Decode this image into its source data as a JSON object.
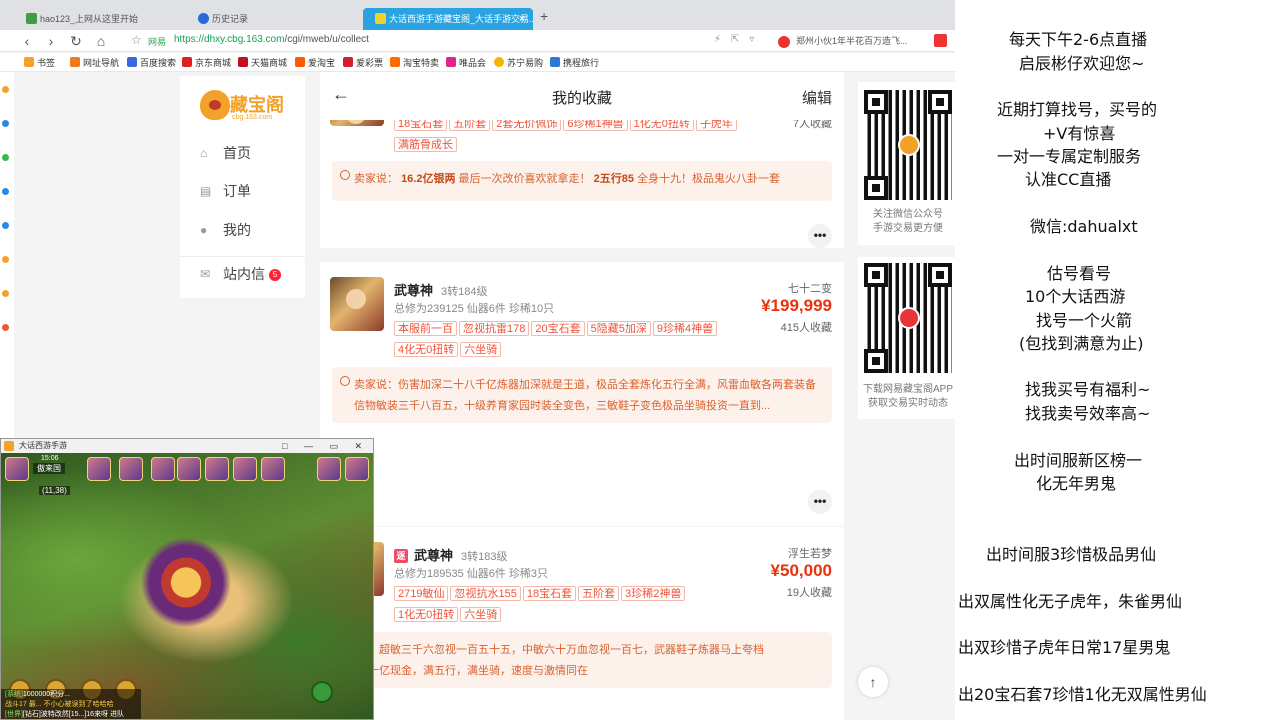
{
  "browser": {
    "tabs": [
      {
        "title": "hao123_上网从这里开始",
        "icon_color": "#3b9e4a"
      },
      {
        "title": "历史记录",
        "icon_color": "#2a6ad8"
      },
      {
        "title": "大话西游手游藏宝阁_大话手游交易...",
        "icon_color": "#f2a22a",
        "active": true
      }
    ],
    "new_tab_icon": "+",
    "tab_close_icon": "×",
    "url_secure_label": "网易",
    "url_scheme": "https://",
    "url_host": "dhxy.cbg.163.com",
    "url_path": "/cgi/mweb/u/collect",
    "search_hint": "郑州小伙1年半花百万造飞..."
  },
  "bookmarks": [
    {
      "label": "书签",
      "color": "#f2a22a"
    },
    {
      "label": "网址导航",
      "color": "#f07a1a"
    },
    {
      "label": "百度搜索",
      "color": "#3a66e0"
    },
    {
      "label": "京东商城",
      "color": "#e02020"
    },
    {
      "label": "天猫商城",
      "color": "#c01020"
    },
    {
      "label": "爱淘宝",
      "color": "#ff5a00"
    },
    {
      "label": "爱彩票",
      "color": "#d02030"
    },
    {
      "label": "淘宝特卖",
      "color": "#ff6a00"
    },
    {
      "label": "唯品会",
      "color": "#e0248a"
    },
    {
      "label": "苏宁易购",
      "color": "#f5b400"
    },
    {
      "label": "携程旅行",
      "color": "#2a78d8"
    }
  ],
  "sidebar": {
    "logo_name": "藏宝阁",
    "logo_sub": "cbg.163.com",
    "items": [
      {
        "label": "首页",
        "icon": "home-icon"
      },
      {
        "label": "订单",
        "icon": "order-icon"
      },
      {
        "label": "我的",
        "icon": "user-icon"
      },
      {
        "label": "站内信",
        "icon": "mail-icon",
        "badge": "5"
      }
    ]
  },
  "header": {
    "title": "我的收藏",
    "edit_label": "编辑",
    "back_icon": "←"
  },
  "listings": [
    {
      "tags": [
        "18宝石套",
        "五阶套",
        "2套无价佩饰",
        "6珍稀1神兽",
        "1化无0扭转",
        "子虎年",
        "满筋骨成长"
      ],
      "favorites": "7人收藏",
      "seller_say_prefix": "卖家说：",
      "seller_say_bold1": "16.2亿银两",
      "seller_say_mid": "最后一次改价喜欢就拿走！",
      "seller_say_bold2": "2五行85",
      "seller_say_tail": "全身十九！极品鬼火八卦一套"
    },
    {
      "name": "武尊神",
      "level": "3转184级",
      "stats": "总修为239125  仙器6件  珍稀10只",
      "server": "七十二变",
      "price": "¥199,999",
      "favorites": "415人收藏",
      "tags": [
        "本服前一百",
        "忽视抗雷178",
        "20宝石套",
        "5隐藏5加深",
        "9珍稀4神兽",
        "4化无0扭转",
        "六坐骑"
      ],
      "seller_say": "卖家说：伤害加深二十八千亿炼器加深就是王道，极品全套炼化五行全满，风雷血敏各两套装备信物敏装三千八百五，十级养育家园时装全变色，三敏鞋子变色极品坐骑投资一直到..."
    },
    {
      "name": "武尊神",
      "level": "3转183级",
      "flag": "逐",
      "stats": "总修为189535  仙器6件  珍稀3只",
      "server": "浮生若梦",
      "price": "¥50,000",
      "favorites": "19人收藏",
      "tags": [
        "2719敏仙",
        "忽视抗水155",
        "18宝石套",
        "五阶套",
        "3珍稀2神兽",
        "1化无0扭转",
        "六坐骑"
      ],
      "seller_say_line1": "家说：超敏三千六忽视一百五十五，中敏六十万血忽视一百七，武器鞋子炼器马上夸档",
      "seller_say_line2": "带三十亿现金，满五行，满坐骑，速度与激情同在"
    }
  ],
  "more_icon": "•••",
  "qr_panels": [
    {
      "caption1": "关注微信公众号",
      "caption2": "手游交易更方便"
    },
    {
      "caption1": "下载网易藏宝阁APP",
      "caption2": "获取交易实时动态"
    }
  ],
  "to_top_icon": "↑",
  "game": {
    "window_title": "大话西游手游",
    "window_buttons": "□ — ▭ ✕",
    "clock": "15:06",
    "player_name": "傲来国",
    "player_pos": "(11,38)",
    "chat": [
      {
        "prefix": "[系统]",
        "text": "1000000积分..."
      },
      {
        "prefix": "",
        "text": "战斗17 最... 不小心被误到了哈哈哈"
      },
      {
        "prefix": "[世界]",
        "text": "[钻石]波特改然[15...]16来呀 进队"
      }
    ]
  },
  "stream_text": [
    "每天下午2-6点直播",
    "启辰彬仔欢迎您~",
    "近期打算找号，买号的",
    "+V有惊喜",
    "一对一专属定制服务",
    "认准CC直播",
    "微信:dahualxt",
    "估号看号",
    "10个大话西游",
    "找号一个火箭",
    "(包找到满意为止)",
    "找我买号有福利~",
    "找我卖号效率高~",
    "出时间服新区榜一",
    "化无年男鬼",
    "出时间服3珍惜极品男仙",
    "出双属性化无子虎年，朱雀男仙",
    "出双珍惜子虎年日常17星男鬼",
    "出20宝石套7珍惜1化无双属性男仙"
  ]
}
